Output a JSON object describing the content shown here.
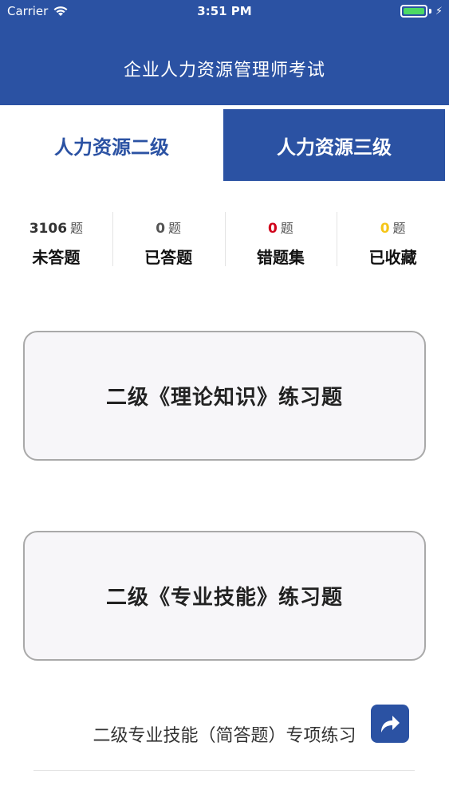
{
  "status_bar": {
    "carrier": "Carrier",
    "time": "3:51 PM",
    "battery_level": 1.0,
    "battery_color": "#4cd964"
  },
  "nav": {
    "title": "企业人力资源管理师考试",
    "background": "#2b52a3"
  },
  "tabs": [
    {
      "label": "人力资源二级",
      "selected": false
    },
    {
      "label": "人力资源三级",
      "selected": true
    }
  ],
  "stats": [
    {
      "count": "3106",
      "unit": "题",
      "label": "未答题",
      "count_color": "#333333"
    },
    {
      "count": "0",
      "unit": "题",
      "label": "已答题",
      "count_color": "#555555"
    },
    {
      "count": "0",
      "unit": "题",
      "label": "错题集",
      "count_color": "#d0021b"
    },
    {
      "count": "0",
      "unit": "题",
      "label": "已收藏",
      "count_color": "#f5c518"
    }
  ],
  "cards": [
    {
      "label": "二级《理论知识》练习题"
    },
    {
      "label": "二级《专业技能》练习题"
    }
  ],
  "special_practice": {
    "label": "二级专业技能（简答题）专项练习"
  },
  "icons": {
    "wifi": "wifi-icon",
    "battery": "battery-icon",
    "charging": "charging-bolt-icon",
    "share": "share-arrow-icon"
  }
}
